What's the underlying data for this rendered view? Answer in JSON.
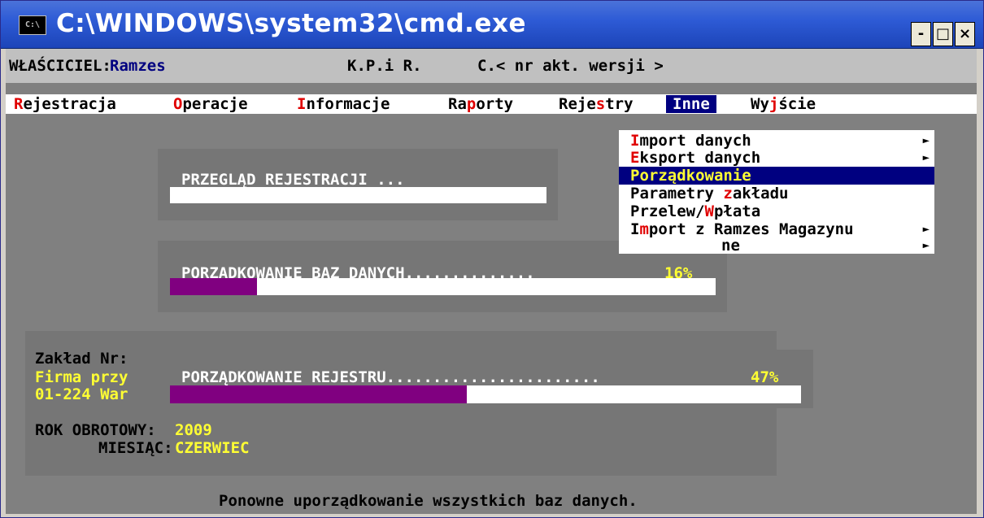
{
  "window": {
    "title": "C:\\WINDOWS\\system32\\cmd.exe",
    "icon_label": "C:\\",
    "buttons": {
      "minimize": "-",
      "maximize": "□",
      "close": "×"
    }
  },
  "header": {
    "owner_label": "WŁAŚCICIEL:",
    "owner_value": "Ramzes",
    "center_text": "K.P.i R.",
    "version_text": "C.< nr akt. wersji >"
  },
  "menu": {
    "items": [
      {
        "hot": "R",
        "rest": "ejestracja"
      },
      {
        "hot": "O",
        "rest": "peracje"
      },
      {
        "hot": "I",
        "rest": "nformacje"
      },
      {
        "pre": "Ra",
        "hot": "p",
        "rest": "orty"
      },
      {
        "pre": "Reje",
        "hot": "s",
        "rest": "try"
      },
      {
        "label": "Inne"
      },
      {
        "pre": "Wy",
        "hot": "j",
        "rest": "ście"
      }
    ]
  },
  "dropdown": {
    "items": [
      {
        "hot": "I",
        "rest": "mport danych",
        "submenu": true
      },
      {
        "hot": "E",
        "rest": "ksport danych",
        "submenu": true
      },
      {
        "label": "Porządkowanie",
        "selected": true
      },
      {
        "pre": "Parametry ",
        "hot": "z",
        "rest": "akładu"
      },
      {
        "pre": "Przelew/",
        "hot": "W",
        "rest": "płata"
      },
      {
        "pre": "I",
        "hot": "m",
        "rest": "port z Ramzes Magazynu",
        "submenu": true
      },
      {
        "rest": "ne",
        "submenu": true
      }
    ]
  },
  "panels": {
    "review": {
      "label": "PRZEGLĄD REJESTRACJI ..."
    },
    "db": {
      "label": "PORZĄDKOWANIE BAZ DANYCH..............",
      "percent_text": "16%",
      "progress": 0.16
    },
    "register": {
      "label": "PORZĄDKOWANIE REJESTRU.......................",
      "percent_text": "47%",
      "progress": 0.47
    }
  },
  "info": {
    "zaklad_label": "Zakład Nr:",
    "firma": "Firma przy",
    "address": "01-224 War",
    "rok_label": "ROK OBROTOWY:",
    "rok_value": "2009",
    "miesiac_label": "MIESIĄC:",
    "miesiac_value": "CZERWIEC"
  },
  "status": {
    "text": "Ponowne uporządkowanie wszystkich baz danych."
  },
  "colors": {
    "console_bg": "#808080",
    "highlight": "#000080",
    "progress_fill": "#800080",
    "accent_yellow": "#ffff33",
    "hotkey_red": "#e00000"
  }
}
